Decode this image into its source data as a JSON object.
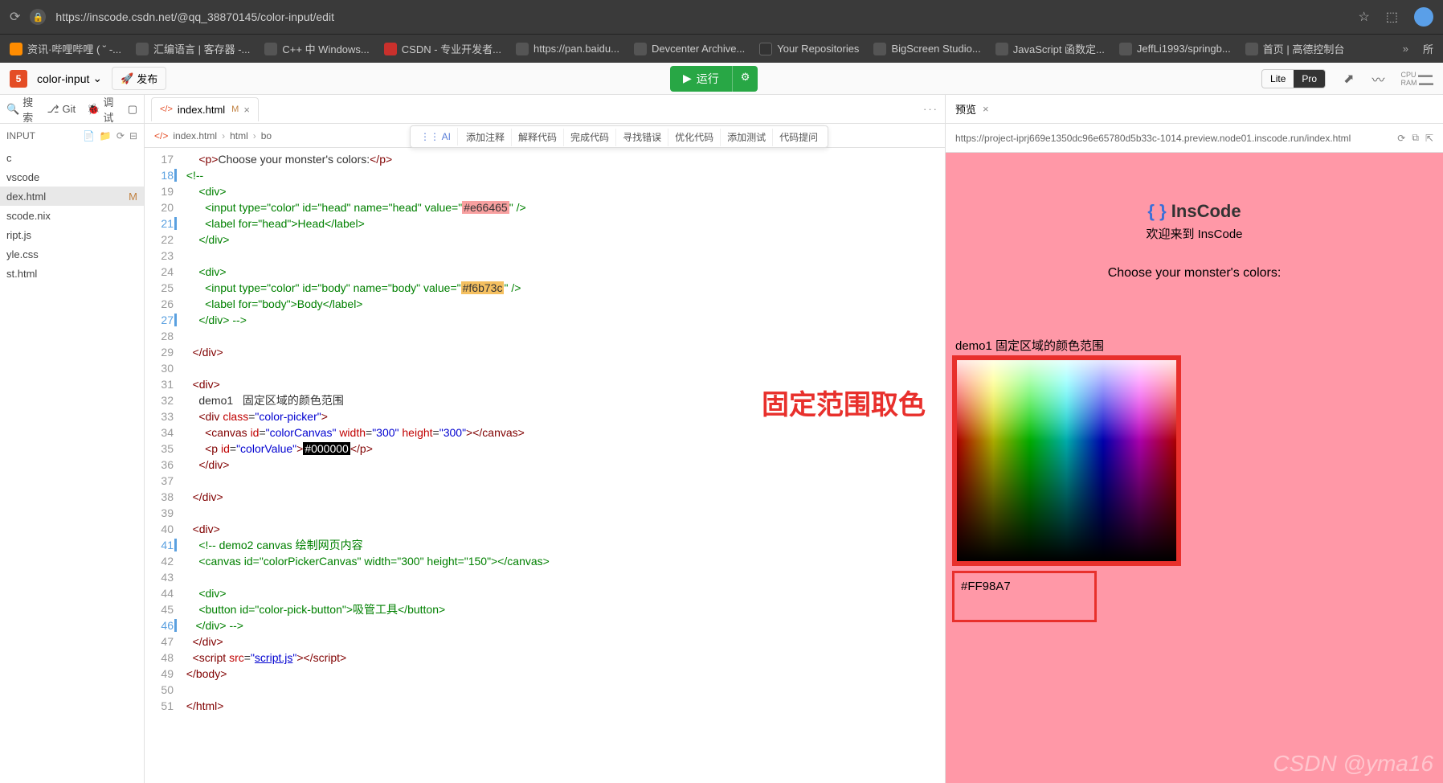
{
  "browser": {
    "url": "https://inscode.csdn.net/@qq_38870145/color-input/edit",
    "bookmarks": [
      {
        "label": "资讯·哔哩哔哩 ( ˘ -...",
        "color": "bm-orange"
      },
      {
        "label": "汇编语言 | 客存器 -...",
        "color": "bm-gray"
      },
      {
        "label": "C++ 中 Windows...",
        "color": "bm-gray"
      },
      {
        "label": "CSDN - 专业开发者...",
        "color": "bm-red"
      },
      {
        "label": "https://pan.baidu...",
        "color": "bm-gray"
      },
      {
        "label": "Devcenter Archive...",
        "color": "bm-gray"
      },
      {
        "label": "Your Repositories",
        "color": "bm-gh"
      },
      {
        "label": "BigScreen Studio...",
        "color": "bm-gray"
      },
      {
        "label": "JavaScript 函数定...",
        "color": "bm-gray"
      },
      {
        "label": "JeffLi1993/springb...",
        "color": "bm-gray"
      },
      {
        "label": "首页 | 高德控制台",
        "color": "bm-gray"
      }
    ],
    "more_bookmarks": "所"
  },
  "toolbar": {
    "project": "color-input",
    "publish": "发布",
    "run": "运行",
    "lite": "Lite",
    "pro": "Pro",
    "ram": "CPU\nRAM"
  },
  "sidebar": {
    "search": "搜索",
    "git": "Git",
    "debug": "调试",
    "header": "INPUT",
    "files": [
      {
        "name": "c",
        "mod": false
      },
      {
        "name": "vscode",
        "mod": false
      },
      {
        "name": "dex.html",
        "mod": true,
        "active": true
      },
      {
        "name": "scode.nix",
        "mod": false
      },
      {
        "name": "ript.js",
        "mod": false
      },
      {
        "name": "yle.css",
        "mod": false
      },
      {
        "name": "st.html",
        "mod": false
      }
    ]
  },
  "editor": {
    "tab": {
      "name": "index.html",
      "mod": "M"
    },
    "breadcrumb": [
      "index.html",
      "html",
      "bo"
    ],
    "ai": {
      "badge": "⋮⋮ AI",
      "items": [
        "添加注释",
        "解释代码",
        "完成代码",
        "寻找错误",
        "优化代码",
        "添加测试",
        "代码提问"
      ]
    },
    "annotation": "固定范围取色",
    "lines": [
      {
        "n": 17,
        "html": "      <span class='tag'>&lt;p&gt;</span><span class='txt'>Choose your monster's colors:</span><span class='tag'>&lt;/p&gt;</span>"
      },
      {
        "n": 18,
        "mod": true,
        "html": "  <span class='cmt'>&lt;!--</span>"
      },
      {
        "n": 19,
        "html": "      <span class='cmt'>&lt;div&gt;</span>"
      },
      {
        "n": 20,
        "html": "        <span class='cmt'>&lt;input type=\"color\" id=\"head\" name=\"head\" value=\"</span><span class='hl-pink'>#e66465</span><span class='cmt'>\" /&gt;</span>"
      },
      {
        "n": 21,
        "mod": true,
        "html": "        <span class='cmt'>&lt;label for=\"head\"&gt;Head&lt;/label&gt;</span>"
      },
      {
        "n": 22,
        "html": "      <span class='cmt'>&lt;/div&gt;</span>"
      },
      {
        "n": 23,
        "html": ""
      },
      {
        "n": 24,
        "html": "      <span class='cmt'>&lt;div&gt;</span>"
      },
      {
        "n": 25,
        "html": "        <span class='cmt'>&lt;input type=\"color\" id=\"body\" name=\"body\" value=\"</span><span class='hl-orange'>#f6b73c</span><span class='cmt'>\" /&gt;</span>"
      },
      {
        "n": 26,
        "html": "        <span class='cmt'>&lt;label for=\"body\"&gt;Body&lt;/label&gt;</span>"
      },
      {
        "n": 27,
        "mod": true,
        "html": "      <span class='cmt'>&lt;/div&gt; --&gt;</span>"
      },
      {
        "n": 28,
        "html": ""
      },
      {
        "n": 29,
        "html": "    <span class='tag'>&lt;/div&gt;</span>"
      },
      {
        "n": 30,
        "html": ""
      },
      {
        "n": 31,
        "html": "    <span class='tag'>&lt;div&gt;</span>"
      },
      {
        "n": 32,
        "html": "      <span class='txt'>demo1   固定区域的颜色范围</span>"
      },
      {
        "n": 33,
        "html": "      <span class='tag'>&lt;div</span> <span class='attr'>class</span>=<span class='val'>\"color-picker\"</span><span class='tag'>&gt;</span>"
      },
      {
        "n": 34,
        "html": "        <span class='tag'>&lt;canvas</span> <span class='attr'>id</span>=<span class='val'>\"colorCanvas\"</span> <span class='attr'>width</span>=<span class='val'>\"300\"</span> <span class='attr'>height</span>=<span class='val'>\"300\"</span><span class='tag'>&gt;&lt;/canvas&gt;</span>"
      },
      {
        "n": 35,
        "html": "        <span class='tag'>&lt;p</span> <span class='attr'>id</span>=<span class='val'>\"colorValue\"</span><span class='tag'>&gt;</span><span class='hl-black'>#000000</span><span class='tag'>&lt;/p&gt;</span>"
      },
      {
        "n": 36,
        "html": "      <span class='tag'>&lt;/div&gt;</span>"
      },
      {
        "n": 37,
        "html": ""
      },
      {
        "n": 38,
        "html": "    <span class='tag'>&lt;/div&gt;</span>"
      },
      {
        "n": 39,
        "html": ""
      },
      {
        "n": 40,
        "html": "    <span class='tag'>&lt;div&gt;</span>"
      },
      {
        "n": 41,
        "mod": true,
        "html": "      <span class='cmt'>&lt;!-- demo2 canvas 绘制网页内容</span>"
      },
      {
        "n": 42,
        "html": "      <span class='cmt'>&lt;canvas id=\"colorPickerCanvas\" width=\"300\" height=\"150\"&gt;&lt;/canvas&gt;</span>"
      },
      {
        "n": 43,
        "html": ""
      },
      {
        "n": 44,
        "html": "      <span class='cmt'>&lt;div&gt;</span>"
      },
      {
        "n": 45,
        "html": "      <span class='cmt'>&lt;button id=\"color-pick-button\"&gt;吸管工具&lt;/button&gt;</span>"
      },
      {
        "n": 46,
        "mod": true,
        "html": "     <span class='cmt'>&lt;/div&gt; --&gt;</span>"
      },
      {
        "n": 47,
        "html": "    <span class='tag'>&lt;/div&gt;</span>"
      },
      {
        "n": 48,
        "html": "    <span class='tag'>&lt;script</span> <span class='attr'>src</span>=<span class='val'>\"<u>script.js</u>\"</span><span class='tag'>&gt;&lt;/script&gt;</span>"
      },
      {
        "n": 49,
        "html": "  <span class='tag'>&lt;/body&gt;</span>"
      },
      {
        "n": 50,
        "html": ""
      },
      {
        "n": 51,
        "html": "  <span class='tag'>&lt;/html&gt;</span>"
      }
    ]
  },
  "preview": {
    "title": "预览",
    "url": "https://project-iprj669e1350dc96e65780d5b33c-1014.preview.node01.inscode.run/index.html",
    "logo_prefix": "{ } ",
    "logo": "InsCode",
    "welcome": "欢迎来到 InsCode",
    "choose": "Choose your monster's colors:",
    "demo_label": "demo1 固定区域的颜色范围",
    "color_value": "#FF98A7",
    "watermark": "CSDN @yma16"
  }
}
